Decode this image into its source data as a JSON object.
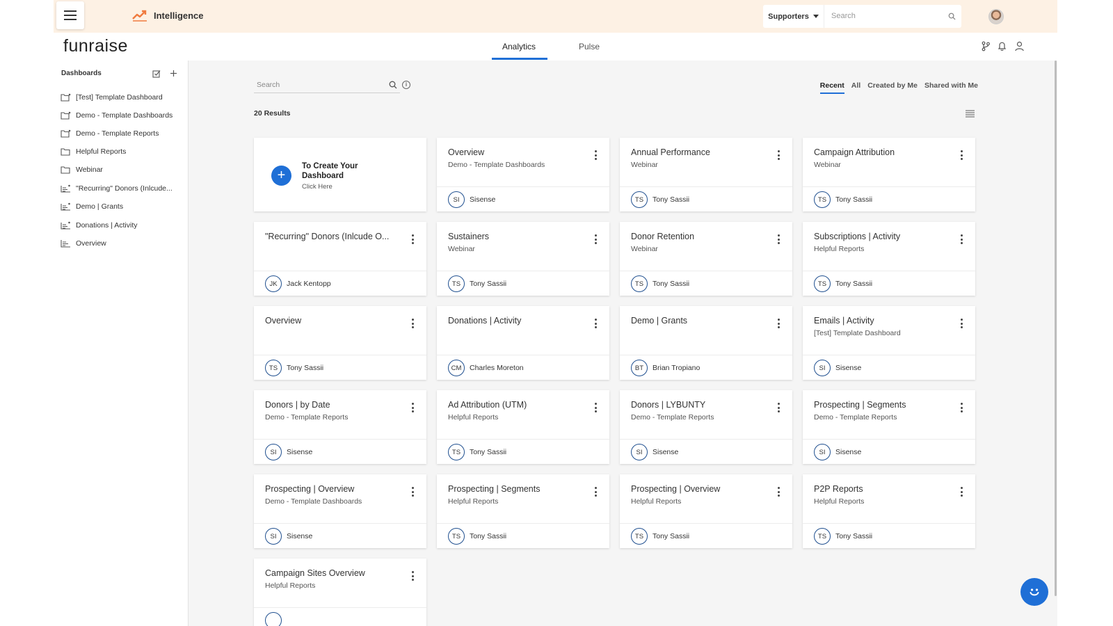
{
  "topbar": {
    "app_title": "Intelligence",
    "supporters_label": "Supporters",
    "search_placeholder": "Search"
  },
  "header": {
    "logo": "funraise",
    "tabs": [
      {
        "label": "Analytics",
        "active": true
      },
      {
        "label": "Pulse",
        "active": false
      }
    ]
  },
  "sidebar": {
    "title": "Dashboards",
    "items": [
      {
        "label": "[Test] Template Dashboard",
        "icon": "shared-folder-icon"
      },
      {
        "label": "Demo - Template Dashboards",
        "icon": "shared-folder-icon"
      },
      {
        "label": "Demo - Template Reports",
        "icon": "shared-folder-icon"
      },
      {
        "label": "Helpful Reports",
        "icon": "folder-icon"
      },
      {
        "label": "Webinar",
        "icon": "folder-icon"
      },
      {
        "label": "\"Recurring\" Donors (Inlcude...",
        "icon": "shared-dashboard-icon"
      },
      {
        "label": "Demo | Grants",
        "icon": "shared-dashboard-icon"
      },
      {
        "label": "Donations | Activity",
        "icon": "shared-dashboard-icon"
      },
      {
        "label": "Overview",
        "icon": "dashboard-icon"
      }
    ]
  },
  "main": {
    "search_placeholder": "Search",
    "filters": [
      {
        "label": "Recent",
        "active": true
      },
      {
        "label": "All",
        "active": false
      },
      {
        "label": "Created by Me",
        "active": false
      },
      {
        "label": "Shared with Me",
        "active": false
      }
    ],
    "results_label": "20 Results",
    "create_card": {
      "title": "To Create Your Dashboard",
      "subtitle": "Click Here"
    },
    "cards": [
      {
        "title": "Overview",
        "subtitle": "Demo - Template Dashboards",
        "initials": "SI",
        "owner": "Sisense"
      },
      {
        "title": "Annual Performance",
        "subtitle": "Webinar",
        "initials": "TS",
        "owner": "Tony Sassii"
      },
      {
        "title": "Campaign Attribution",
        "subtitle": "Webinar",
        "initials": "TS",
        "owner": "Tony Sassii"
      },
      {
        "title": "\"Recurring\" Donors (Inlcude O...",
        "subtitle": "",
        "initials": "JK",
        "owner": "Jack Kentopp"
      },
      {
        "title": "Sustainers",
        "subtitle": "Webinar",
        "initials": "TS",
        "owner": "Tony Sassii"
      },
      {
        "title": "Donor Retention",
        "subtitle": "Webinar",
        "initials": "TS",
        "owner": "Tony Sassii"
      },
      {
        "title": "Subscriptions | Activity",
        "subtitle": "Helpful Reports",
        "initials": "TS",
        "owner": "Tony Sassii"
      },
      {
        "title": "Overview",
        "subtitle": "",
        "initials": "TS",
        "owner": "Tony Sassii"
      },
      {
        "title": "Donations | Activity",
        "subtitle": "",
        "initials": "CM",
        "owner": "Charles Moreton"
      },
      {
        "title": "Demo | Grants",
        "subtitle": "",
        "initials": "BT",
        "owner": "Brian Tropiano"
      },
      {
        "title": "Emails | Activity",
        "subtitle": "[Test] Template Dashboard",
        "initials": "SI",
        "owner": "Sisense"
      },
      {
        "title": "Donors | by Date",
        "subtitle": "Demo - Template Reports",
        "initials": "SI",
        "owner": "Sisense"
      },
      {
        "title": "Ad Attribution (UTM)",
        "subtitle": "Helpful Reports",
        "initials": "TS",
        "owner": "Tony Sassii"
      },
      {
        "title": "Donors | LYBUNTY",
        "subtitle": "Demo - Template Reports",
        "initials": "SI",
        "owner": "Sisense"
      },
      {
        "title": "Prospecting | Segments",
        "subtitle": "Demo - Template Reports",
        "initials": "SI",
        "owner": "Sisense"
      },
      {
        "title": "Prospecting | Overview",
        "subtitle": "Demo - Template Dashboards",
        "initials": "SI",
        "owner": "Sisense"
      },
      {
        "title": "Prospecting | Segments",
        "subtitle": "Helpful Reports",
        "initials": "TS",
        "owner": "Tony Sassii"
      },
      {
        "title": "Prospecting | Overview",
        "subtitle": "Helpful Reports",
        "initials": "TS",
        "owner": "Tony Sassii"
      },
      {
        "title": "P2P Reports",
        "subtitle": "Helpful Reports",
        "initials": "TS",
        "owner": "Tony Sassii"
      },
      {
        "title": "Campaign Sites Overview",
        "subtitle": "Helpful Reports",
        "initials": "",
        "owner": ""
      }
    ]
  },
  "colors": {
    "accent": "#1f6fd6",
    "topbar_bg": "#fdf1e4",
    "app_icon": "#f07b3f"
  }
}
